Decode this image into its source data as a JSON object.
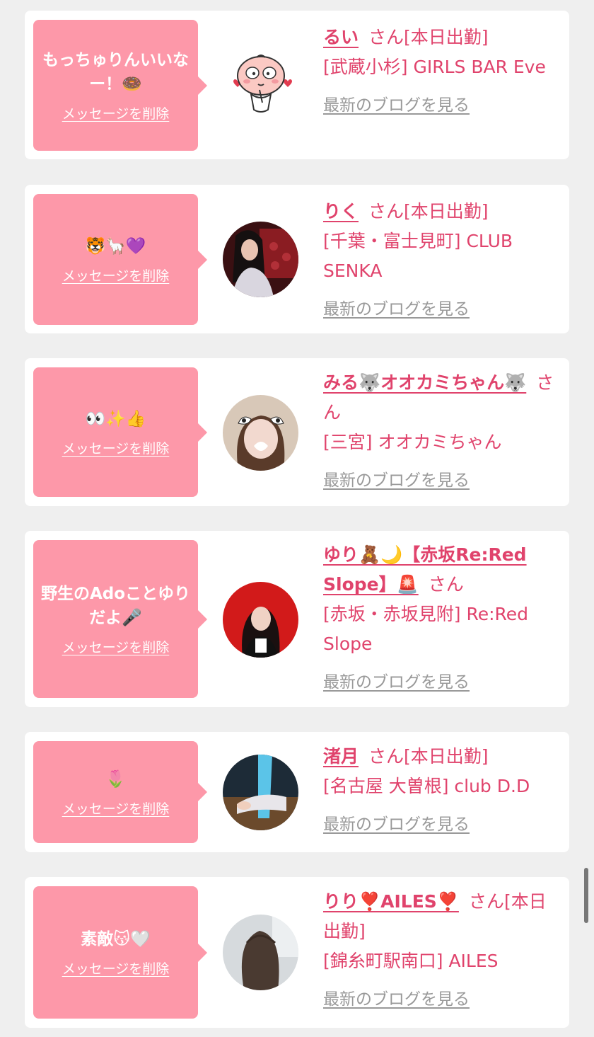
{
  "delete_label": "メッセージを削除",
  "blog_label": "最新のブログを見る",
  "san_label": "さん",
  "colors": {
    "accent": "#e0436c",
    "bubble": "#fd98a9",
    "link_gray": "#999999",
    "background": "#efefef"
  },
  "items": [
    {
      "message": "もっちゅりんいいなー！🍩",
      "name": "るい",
      "status": "[本日出勤]",
      "shop": "[武蔵小杉] GIRLS BAR Eve"
    },
    {
      "message": "🐯🦙💜",
      "name": "りく",
      "status": "[本日出勤]",
      "shop": "[千葉・富士見町] CLUB SENKA"
    },
    {
      "message": "👀✨👍",
      "name": "みる🐺オオカミちゃん🐺",
      "status": "",
      "shop": "[三宮] オオカミちゃん"
    },
    {
      "message": "野生のAdoことゆりだよ🎤",
      "name": "ゆり🧸🌙【赤坂Re:Red Slope】🚨",
      "status": "",
      "shop": "[赤坂・赤坂見附] Re:Red Slope"
    },
    {
      "message": "🌷",
      "name": "渚月",
      "status": "[本日出勤]",
      "shop": "[名古屋 大曽根] club D.D"
    },
    {
      "message": "素敵😽🤍",
      "name": "りり❣️AILES❣️",
      "status": "[本日出勤]",
      "shop": "[錦糸町駅南口] AILES"
    }
  ]
}
